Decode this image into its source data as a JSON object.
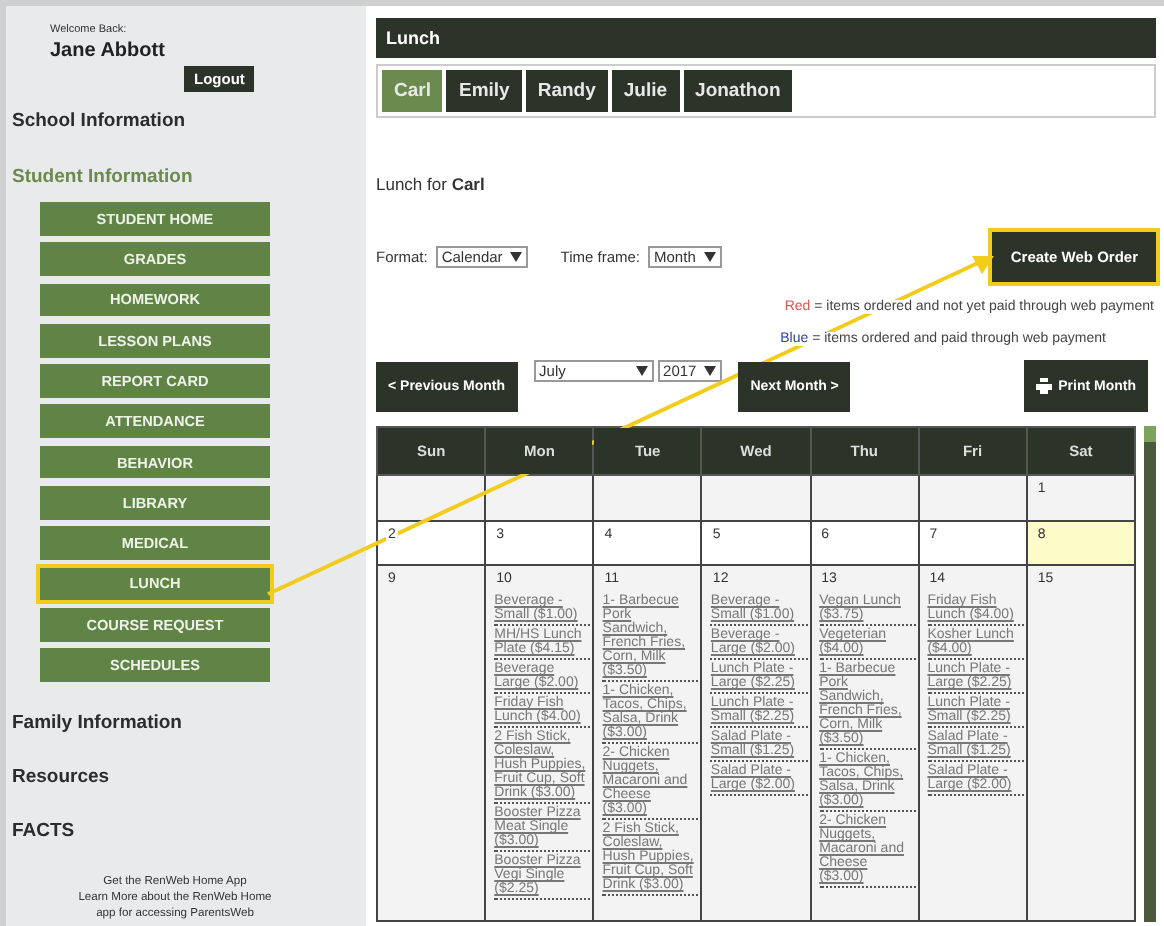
{
  "sidebar": {
    "welcome": "Welcome Back:",
    "user_name": "Jane Abbott",
    "logout": "Logout",
    "sections_top": [
      {
        "label": "School Information",
        "active": false
      },
      {
        "label": "Student Information",
        "active": true
      }
    ],
    "nav": [
      {
        "label": "STUDENT HOME",
        "highlighted": false
      },
      {
        "label": "GRADES",
        "highlighted": false
      },
      {
        "label": "HOMEWORK",
        "highlighted": false
      },
      {
        "label": "LESSON PLANS",
        "highlighted": false
      },
      {
        "label": "REPORT CARD",
        "highlighted": false
      },
      {
        "label": "ATTENDANCE",
        "highlighted": false
      },
      {
        "label": "BEHAVIOR",
        "highlighted": false
      },
      {
        "label": "LIBRARY",
        "highlighted": false
      },
      {
        "label": "MEDICAL",
        "highlighted": false
      },
      {
        "label": "LUNCH",
        "highlighted": true
      },
      {
        "label": "COURSE REQUEST",
        "highlighted": false
      },
      {
        "label": "SCHEDULES",
        "highlighted": false
      }
    ],
    "sections_bottom": [
      {
        "label": "Family Information",
        "active": false
      },
      {
        "label": "Resources",
        "active": false
      },
      {
        "label": "FACTS",
        "active": false
      }
    ],
    "footer": {
      "title": "Get the RenWeb Home App",
      "text": "Learn More about the RenWeb Home",
      "text_cut": "app for accessing ParentsWeb"
    }
  },
  "header": {
    "title": "Lunch"
  },
  "tabs": [
    {
      "label": "Carl",
      "selected": true
    },
    {
      "label": "Emily",
      "selected": false
    },
    {
      "label": "Randy",
      "selected": false
    },
    {
      "label": "Julie",
      "selected": false
    },
    {
      "label": "Jonathon",
      "selected": false
    }
  ],
  "lunch_for": "Lunch for **Carl**",
  "format": {
    "label": "Format:",
    "value": "Calendar"
  },
  "time_frame": {
    "label": "Time frame:",
    "value": "Month"
  },
  "create_button": {
    "label": "Create Web Order",
    "highlighted": true
  },
  "legend": [
    {
      "word": "Red",
      "color": "#d9534f",
      "text": "= items ordered and not yet paid through web payment"
    },
    {
      "word": "Blue",
      "color": "#2f3fa8",
      "text": "= items ordered and paid through web payment"
    }
  ],
  "nav_bar": {
    "previous": "< Previous Month",
    "month": "July",
    "year": "2017",
    "next": "Next Month >",
    "print": "Print Month"
  },
  "calendar": {
    "days": [
      "Sun",
      "Mon",
      "Tue",
      "Wed",
      "Thu",
      "Fri",
      "Sat"
    ],
    "weeks": [
      {
        "cells": [
          {
            "kind": "empty"
          },
          {
            "kind": "empty"
          },
          {
            "kind": "empty"
          },
          {
            "kind": "empty"
          },
          {
            "kind": "empty"
          },
          {
            "kind": "empty"
          },
          {
            "kind": "day",
            "day": "1",
            "today": false
          }
        ]
      },
      {
        "cells": [
          {
            "kind": "day",
            "day": "2",
            "today": false
          },
          {
            "kind": "day",
            "day": "3",
            "today": false
          },
          {
            "kind": "day",
            "day": "4",
            "today": false
          },
          {
            "kind": "day",
            "day": "5",
            "today": false
          },
          {
            "kind": "day",
            "day": "6",
            "today": false
          },
          {
            "kind": "day",
            "day": "7",
            "today": false
          },
          {
            "kind": "day",
            "day": "8",
            "today": true
          }
        ]
      },
      {
        "cells": [
          {
            "kind": "day",
            "day": "9",
            "today": false
          },
          {
            "kind": "day",
            "day": "10",
            "today": false,
            "items": [
              "Beverage - Small ($1.00)",
              "MH/HS Lunch Plate ($4.15)",
              "Beverage Large ($2.00)",
              "Friday Fish Lunch ($4.00)",
              "2 Fish Stick, Coleslaw, Hush Puppies, Fruit Cup, Soft Drink ($3.00)",
              "Booster Pizza Meat Single ($3.00)",
              "Booster Pizza Vegi Single ($2.25)"
            ]
          },
          {
            "kind": "day",
            "day": "11",
            "today": false,
            "items": [
              "1- Barbecue Pork Sandwich, French Fries, Corn, Milk ($3.50)",
              "1- Chicken, Tacos, Chips, Salsa, Drink ($3.00)",
              "2- Chicken Nuggets, Macaroni and Cheese ($3.00)",
              "2 Fish Stick, Coleslaw, Hush Puppies, Fruit Cup, Soft Drink ($3.00)"
            ]
          },
          {
            "kind": "day",
            "day": "12",
            "today": false,
            "items": [
              "Beverage - Small ($1.00)",
              "Beverage - Large ($2.00)",
              "Lunch Plate - Large ($2.25)",
              "Lunch Plate - Small ($2.25)",
              "Salad Plate - Small ($1.25)",
              "Salad Plate - Large ($2.00)"
            ]
          },
          {
            "kind": "day",
            "day": "13",
            "today": false,
            "items": [
              "Vegan Lunch ($3.75)",
              "Vegeterian ($4.00)",
              "1- Barbecue Pork Sandwich, French Fries, Corn, Milk ($3.50)",
              "1- Chicken, Tacos, Chips, Salsa, Drink ($3.00)",
              "2- Chicken Nuggets, Macaroni and Cheese ($3.00)"
            ]
          },
          {
            "kind": "day",
            "day": "14",
            "today": false,
            "items": [
              "Friday Fish Lunch ($4.00)",
              "Kosher Lunch ($4.00)",
              "Lunch Plate - Large ($2.25)",
              "Lunch Plate - Small ($2.25)",
              "Salad Plate - Small ($1.25)",
              "Salad Plate - Large ($2.00)"
            ]
          },
          {
            "kind": "day",
            "day": "15",
            "today": false
          }
        ]
      }
    ]
  }
}
